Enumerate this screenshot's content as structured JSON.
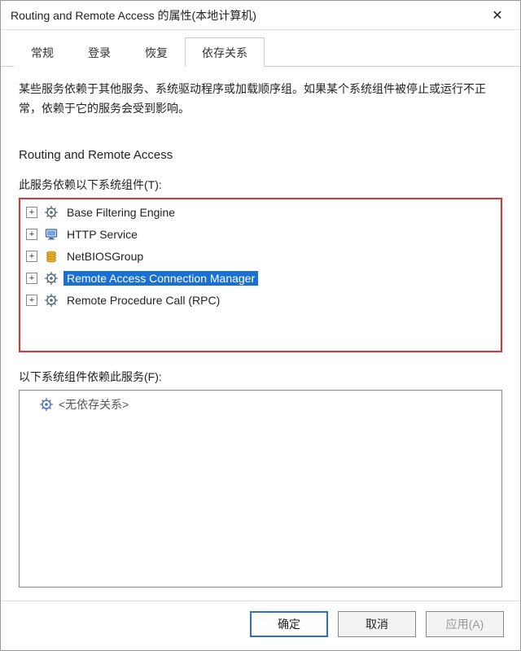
{
  "titlebar": {
    "title": "Routing and Remote Access 的属性(本地计算机)"
  },
  "tabs": {
    "general": "常规",
    "logon": "登录",
    "recovery": "恢复",
    "dependencies": "依存关系"
  },
  "content": {
    "description": "某些服务依赖于其他服务、系统驱动程序或加载顺序组。如果某个系统组件被停止或运行不正常，依赖于它的服务会受到影响。",
    "service_name": "Routing and Remote Access",
    "depends_on_label": "此服务依赖以下系统组件(T):",
    "depends_on_items": [
      {
        "label": "Base Filtering Engine",
        "icon": "gear",
        "selected": false
      },
      {
        "label": "HTTP Service",
        "icon": "monitor",
        "selected": false
      },
      {
        "label": "NetBIOSGroup",
        "icon": "stack",
        "selected": false
      },
      {
        "label": "Remote Access Connection Manager",
        "icon": "gear",
        "selected": true
      },
      {
        "label": "Remote Procedure Call (RPC)",
        "icon": "gear",
        "selected": false
      }
    ],
    "required_by_label": "以下系统组件依赖此服务(F):",
    "no_dependencies_label": "<无依存关系>"
  },
  "buttons": {
    "ok": "确定",
    "cancel": "取消",
    "apply": "应用(A)"
  }
}
